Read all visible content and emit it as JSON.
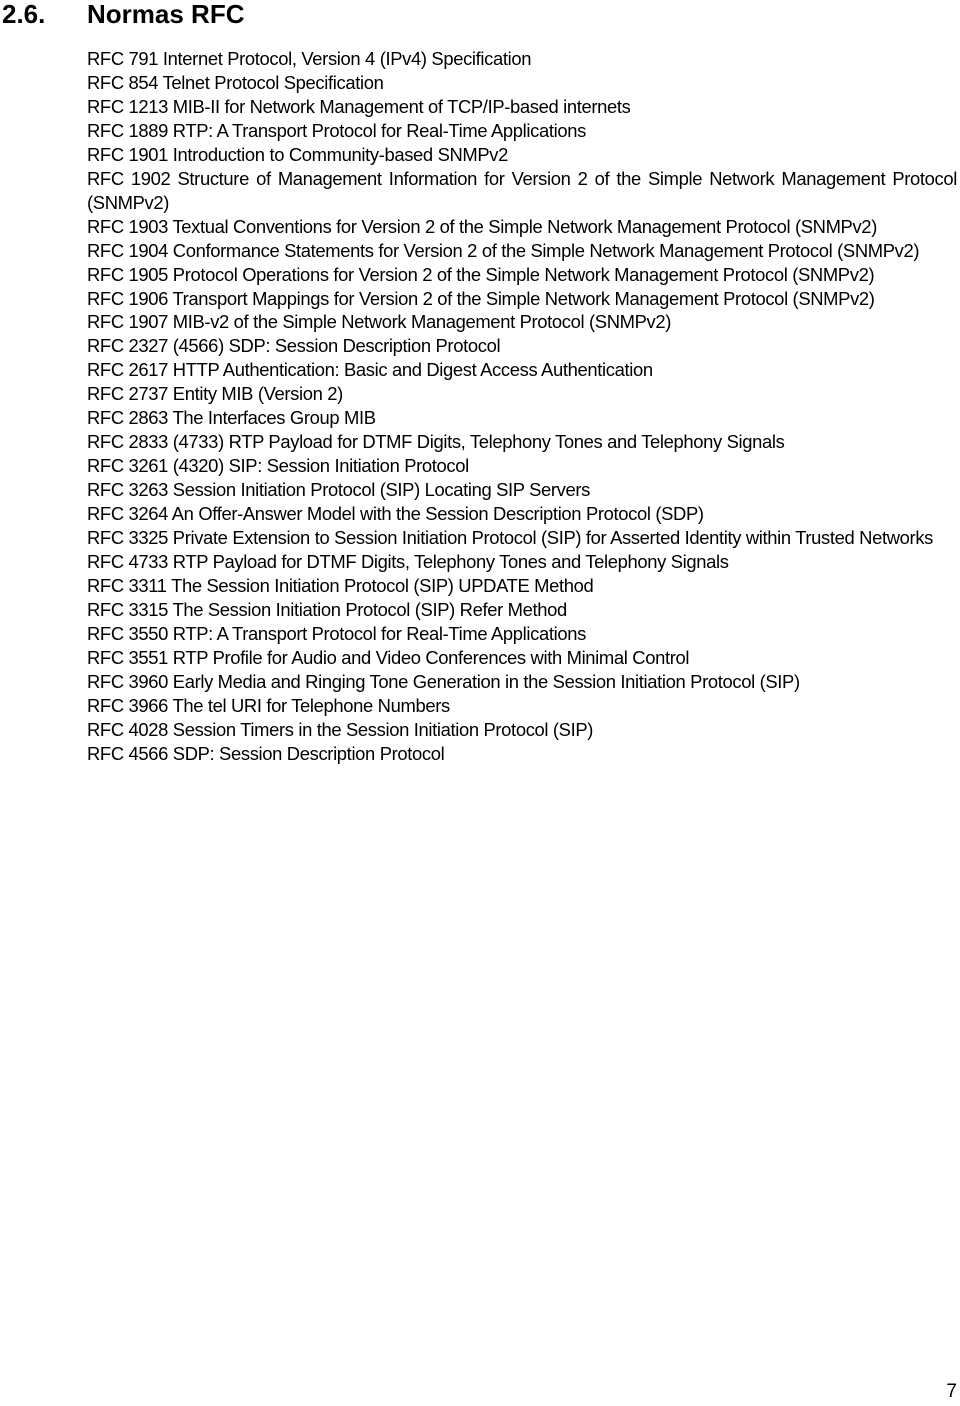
{
  "section": {
    "number": "2.6.",
    "title": "Normas RFC"
  },
  "rfc_list": [
    {
      "text": "RFC 791 Internet Protocol, Version 4 (IPv4) Specification",
      "wraps": false
    },
    {
      "text": "RFC 854 Telnet Protocol Specification",
      "wraps": false
    },
    {
      "text": "RFC 1213 MIB-II for Network Management of TCP/IP-based internets",
      "wraps": false
    },
    {
      "text": "RFC 1889 RTP: A Transport Protocol for Real-Time Applications",
      "wraps": false
    },
    {
      "text": "RFC 1901 Introduction to Community-based SNMPv2",
      "wraps": false
    },
    {
      "text": "RFC 1902 Structure of Management Information for Version 2 of the Simple Network Management Protocol (SNMPv2)",
      "wraps": true
    },
    {
      "text": "RFC 1903 Textual Conventions for Version 2 of the Simple Network Management Protocol (SNMPv2)",
      "wraps": true
    },
    {
      "text": "RFC 1904 Conformance Statements for Version 2 of the Simple Network Management Protocol (SNMPv2)",
      "wraps": true
    },
    {
      "text": "RFC 1905 Protocol Operations for Version 2 of the Simple Network Management Protocol (SNMPv2)",
      "wraps": true
    },
    {
      "text": "RFC 1906 Transport Mappings for Version 2 of the Simple Network Management Protocol (SNMPv2)",
      "wraps": true
    },
    {
      "text": "RFC 1907 MIB-v2 of the Simple Network Management Protocol (SNMPv2)",
      "wraps": false
    },
    {
      "text": "RFC 2327 (4566) SDP: Session Description Protocol",
      "wraps": false
    },
    {
      "text": "RFC 2617 HTTP Authentication: Basic and Digest Access Authentication",
      "wraps": false
    },
    {
      "text": "RFC 2737 Entity MIB (Version 2)",
      "wraps": false
    },
    {
      "text": "RFC 2863 The Interfaces Group MIB",
      "wraps": false
    },
    {
      "text": "RFC 2833 (4733) RTP Payload for DTMF Digits, Telephony Tones and Telephony Signals",
      "wraps": false
    },
    {
      "text": "RFC 3261 (4320) SIP: Session Initiation Protocol",
      "wraps": false
    },
    {
      "text": "RFC 3263 Session Initiation Protocol (SIP) Locating SIP Servers",
      "wraps": false
    },
    {
      "text": "RFC 3264 An Offer-Answer Model with the Session Description Protocol (SDP)",
      "wraps": false
    },
    {
      "text": "RFC 3325 Private Extension to Session Initiation Protocol (SIP) for Asserted Identity within Trusted Networks",
      "wraps": true
    },
    {
      "text": "RFC 4733 RTP Payload for DTMF Digits, Telephony Tones and Telephony Signals",
      "wraps": false
    },
    {
      "text": "RFC 3311 The Session Initiation Protocol (SIP) UPDATE Method",
      "wraps": false
    },
    {
      "text": "RFC 3315 The Session Initiation Protocol (SIP) Refer Method",
      "wraps": false
    },
    {
      "text": "RFC 3550 RTP: A Transport Protocol for Real-Time Applications",
      "wraps": false
    },
    {
      "text": "RFC 3551 RTP Profile for Audio and Video Conferences with Minimal Control",
      "wraps": false
    },
    {
      "text": "RFC 3960 Early Media and Ringing Tone Generation in the Session Initiation Protocol (SIP)",
      "wraps": false
    },
    {
      "text": "RFC 3966 The tel URI for Telephone Numbers",
      "wraps": false
    },
    {
      "text": "RFC 4028 Session Timers in the Session Initiation Protocol (SIP)",
      "wraps": false
    },
    {
      "text": "RFC 4566 SDP: Session Description Protocol",
      "wraps": false
    }
  ],
  "footer": {
    "page_number": "7"
  }
}
